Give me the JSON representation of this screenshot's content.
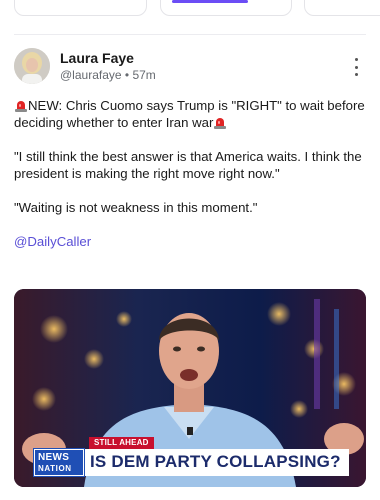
{
  "post": {
    "author_name": "Laura Faye",
    "handle": "@laurafaye",
    "separator": "•",
    "time_ago": "57m",
    "paragraph_1": "NEW: Chris Cuomo says Trump is \"RIGHT\" to wait before deciding whether to enter Iran war",
    "paragraph_2": "\"I still think the best answer is that America waits. I think the president is making the right move right now.\"",
    "paragraph_3": "\"Waiting is not weakness in this moment.\"",
    "mention": "@DailyCaller"
  },
  "media": {
    "banner_tag": "STILL AHEAD",
    "logo_line_1": "NEWS",
    "logo_line_2": "NATION",
    "headline": "IS DEM PARTY COLLAPSING?"
  },
  "icons": {
    "siren": "siren-emoji",
    "more": "more-vertical-icon"
  },
  "colors": {
    "accent": "#6b4df5",
    "mention": "#5a4fd6",
    "siren": "#e02424",
    "chyron_red": "#c8102e",
    "chyron_blue": "#1f4fb5",
    "headline_text": "#1c2b6b"
  }
}
